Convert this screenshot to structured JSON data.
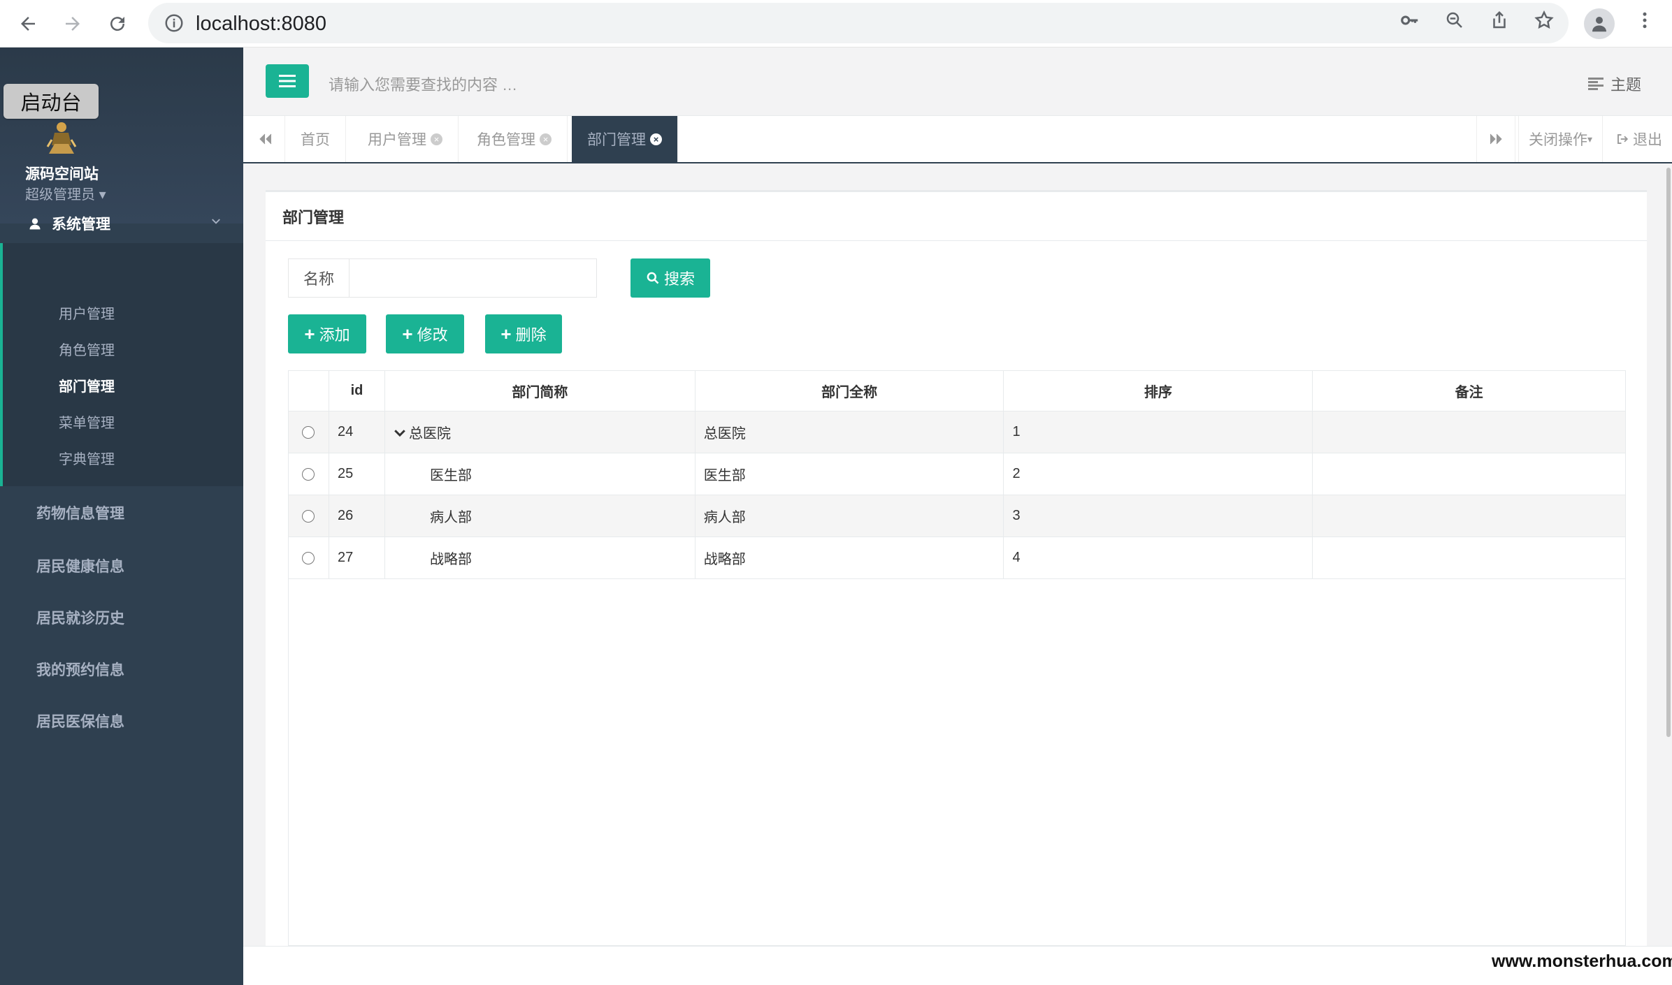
{
  "browser": {
    "url": "localhost:8080",
    "icons": [
      "back-arrow-icon",
      "forward-arrow-icon",
      "reload-icon",
      "info-icon",
      "key-icon",
      "zoom-icon",
      "share-icon",
      "star-icon",
      "profile-icon",
      "kebab-menu-icon"
    ]
  },
  "sidebar": {
    "launcher": "启动台",
    "site_name": "源码空间站",
    "role": "超级管理员",
    "group": {
      "label": "系统管理",
      "items": [
        {
          "label": "用户管理",
          "active": false
        },
        {
          "label": "角色管理",
          "active": false
        },
        {
          "label": "部门管理",
          "active": true
        },
        {
          "label": "菜单管理",
          "active": false
        },
        {
          "label": "字典管理",
          "active": false
        }
      ]
    },
    "menu": [
      "药物信息管理",
      "居民健康信息",
      "居民就诊历史",
      "我的预约信息",
      "居民医保信息"
    ]
  },
  "header": {
    "search_placeholder": "请输入您需要查找的内容 …",
    "theme": "主题"
  },
  "tabs": [
    {
      "label": "首页",
      "closable": false,
      "active": false
    },
    {
      "label": "用户管理",
      "closable": true,
      "active": false
    },
    {
      "label": "角色管理",
      "closable": true,
      "active": false
    },
    {
      "label": "部门管理",
      "closable": true,
      "active": true
    }
  ],
  "tab_actions": {
    "close_ops": "关闭操作",
    "logout": "退出"
  },
  "panel": {
    "title": "部门管理",
    "search_label": "名称",
    "search_value": "",
    "search_button": "搜索",
    "buttons": {
      "add": "添加",
      "edit": "修改",
      "delete": "删除"
    }
  },
  "table": {
    "columns": [
      "",
      "id",
      "部门简称",
      "部门全称",
      "排序",
      "备注"
    ],
    "rows": [
      {
        "id": "24",
        "short": "总医院",
        "full": "总医院",
        "order": "1",
        "note": "",
        "expandable": true
      },
      {
        "id": "25",
        "short": "医生部",
        "full": "医生部",
        "order": "2",
        "note": ""
      },
      {
        "id": "26",
        "short": "病人部",
        "full": "病人部",
        "order": "3",
        "note": ""
      },
      {
        "id": "27",
        "short": "战略部",
        "full": "战略部",
        "order": "4",
        "note": ""
      }
    ]
  },
  "watermark": "www.monsterhua.com",
  "colors": {
    "primary": "#1ab394",
    "sidebar": "#2f4050",
    "sidebar_text": "#a7b1c2"
  }
}
